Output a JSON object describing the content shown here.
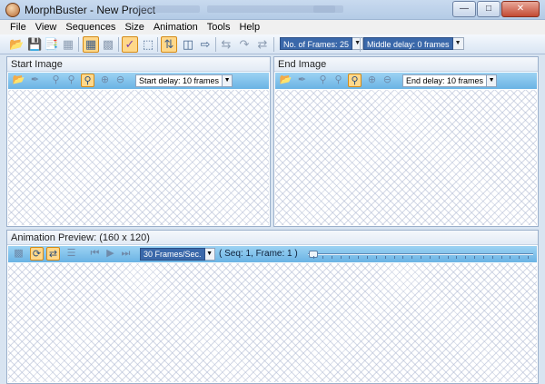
{
  "window": {
    "title": "MorphBuster - New Project",
    "app_icon": "morphbuster-app-icon",
    "controls": [
      "minimize",
      "maximize",
      "close"
    ]
  },
  "menu": [
    "File",
    "View",
    "Sequences",
    "Size",
    "Animation",
    "Tools",
    "Help"
  ],
  "toolbar": {
    "icons": [
      "open-folder-icon",
      "save-icon",
      "save-as-icon",
      "properties-icon",
      "film-icon",
      "brush-icon",
      "select-rectangle-icon",
      "sequence-icon",
      "frames-icon",
      "export-icon",
      "undo-icon",
      "redo-icon",
      "swap-icon"
    ],
    "frames_combo": "No. of Frames: 25",
    "middle_delay_combo": "Middle delay: 0 frames"
  },
  "start_panel": {
    "title": "Start Image",
    "delay_combo": "Start delay: 10 frames",
    "icons": [
      "open-folder-icon",
      "eyedropper-icon",
      "zoom-fit-icon",
      "zoom-in-icon",
      "zoom-actual-icon",
      "zoom-plus-icon",
      "zoom-minus-icon"
    ]
  },
  "end_panel": {
    "title": "End Image",
    "delay_combo": "End delay: 10 frames",
    "icons": [
      "open-folder-icon",
      "eyedropper-icon",
      "zoom-fit-icon",
      "zoom-in-icon",
      "zoom-actual-icon",
      "zoom-plus-icon",
      "zoom-minus-icon"
    ]
  },
  "preview_panel": {
    "title": "Animation Preview:  (160 x 120)",
    "fps_combo": "30 Frames/Sec.",
    "status": "( Seq: 1, Frame: 1 )",
    "icons": [
      "film-icon",
      "loop-icon",
      "pingpong-icon",
      "frames-strip-icon",
      "first-frame-icon",
      "play-icon",
      "last-frame-icon"
    ],
    "frame_position": 1,
    "slider_ticks": 25
  },
  "colors": {
    "panel_toolbar": "#6ab3e4",
    "accent_combo": "#3a68aa",
    "active_button": "#ffd88a"
  }
}
